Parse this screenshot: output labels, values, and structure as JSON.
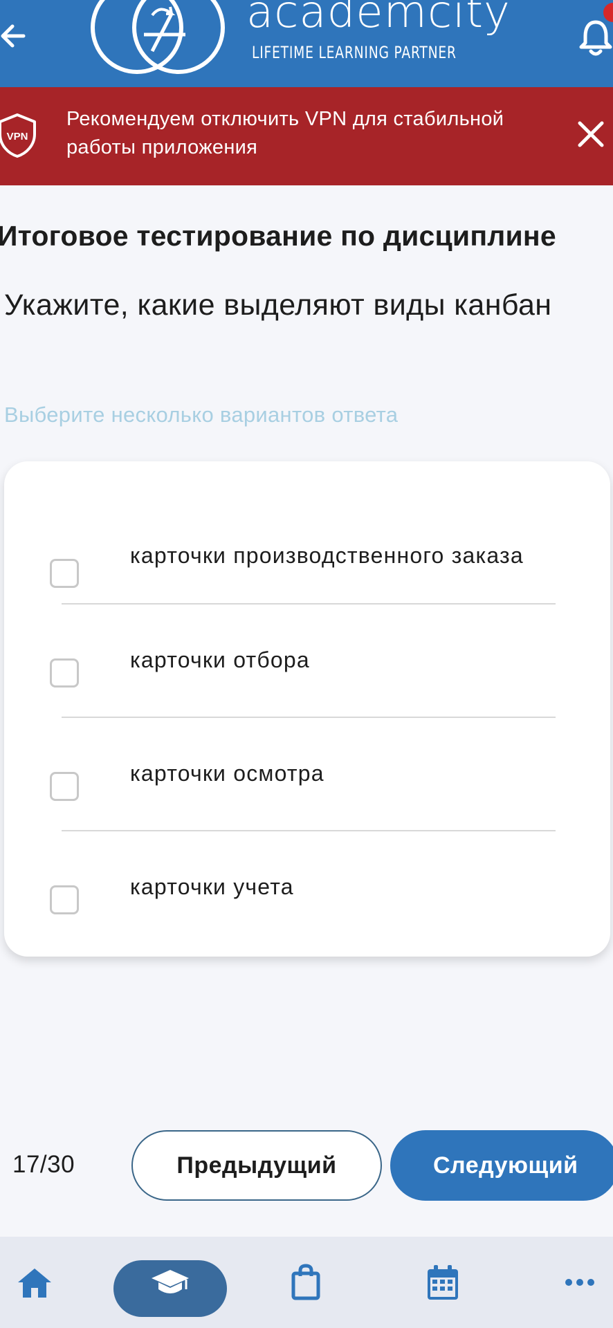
{
  "header": {
    "brand_name": "academcity",
    "brand_tagline": "LIFETIME LEARNING PARTNER",
    "background_color": "#2f75bb",
    "back_icon": "arrow-left-icon",
    "notification_icon": "bell-icon"
  },
  "vpn_banner": {
    "badge": "VPN",
    "message": "Рекомендуем отключить VPN для стабильной работы приложения",
    "close_icon": "close-icon",
    "background_color": "#a72428"
  },
  "test": {
    "title": "Итоговое тестирование по дисциплине",
    "question": "Укажите, какие выделяют виды канбан",
    "hint": "Выберите несколько вариантов ответа",
    "options": [
      {
        "label": "карточки производственного заказа",
        "checked": false
      },
      {
        "label": "карточки отбора",
        "checked": false
      },
      {
        "label": "карточки осмотра",
        "checked": false
      },
      {
        "label": "карточки учета",
        "checked": false
      }
    ]
  },
  "navigation": {
    "counter": "17/30",
    "prev_label": "Предыдущий",
    "next_label": "Следующий"
  },
  "bottom_nav": {
    "items": [
      {
        "icon": "home-icon",
        "active": false
      },
      {
        "icon": "graduation-cap-icon",
        "active": true
      },
      {
        "icon": "shopping-bag-icon",
        "active": false
      },
      {
        "icon": "calendar-icon",
        "active": false
      },
      {
        "icon": "more-horizontal-icon",
        "active": false
      }
    ],
    "active_color": "#3a6b9d",
    "icon_color": "#2f75bb"
  }
}
